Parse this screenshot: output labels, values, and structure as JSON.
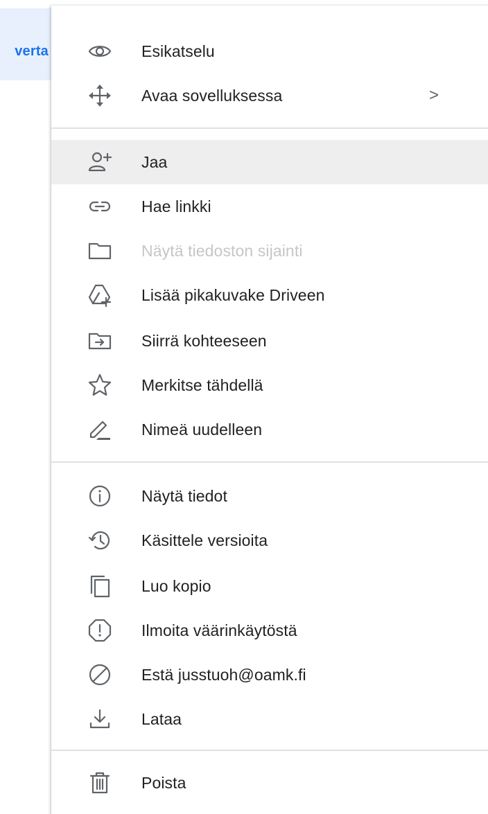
{
  "background": {
    "partial_tab_label": "verta"
  },
  "menu": {
    "items": [
      {
        "label": "Esikatselu",
        "icon": "eye-icon"
      },
      {
        "label": "Avaa sovelluksessa",
        "icon": "move-arrows-icon",
        "submenu_indicator": ">"
      },
      {
        "label": "Jaa",
        "icon": "person-add-icon",
        "highlighted": true
      },
      {
        "label": "Hae linkki",
        "icon": "link-icon"
      },
      {
        "label": "Näytä tiedoston sijainti",
        "icon": "folder-icon",
        "disabled": true
      },
      {
        "label": "Lisää pikakuvake Driveen",
        "icon": "drive-shortcut-add-icon"
      },
      {
        "label": "Siirrä kohteeseen",
        "icon": "folder-move-icon"
      },
      {
        "label": "Merkitse tähdellä",
        "icon": "star-icon"
      },
      {
        "label": "Nimeä uudelleen",
        "icon": "pencil-icon"
      },
      {
        "label": "Näytä tiedot",
        "icon": "info-icon"
      },
      {
        "label": "Käsittele versioita",
        "icon": "history-icon"
      },
      {
        "label": "Luo kopio",
        "icon": "copy-icon"
      },
      {
        "label": "Ilmoita väärinkäytöstä",
        "icon": "report-icon"
      },
      {
        "label": "Estä jusstuoh@oamk.fi",
        "icon": "block-icon"
      },
      {
        "label": "Lataa",
        "icon": "download-icon"
      },
      {
        "label": "Poista",
        "icon": "trash-icon"
      }
    ]
  },
  "colors": {
    "icon": "#5f6368",
    "text": "#202124",
    "disabled_text": "#c4c6c9",
    "highlight": "#eeeeee",
    "accent": "#1a73e8"
  }
}
